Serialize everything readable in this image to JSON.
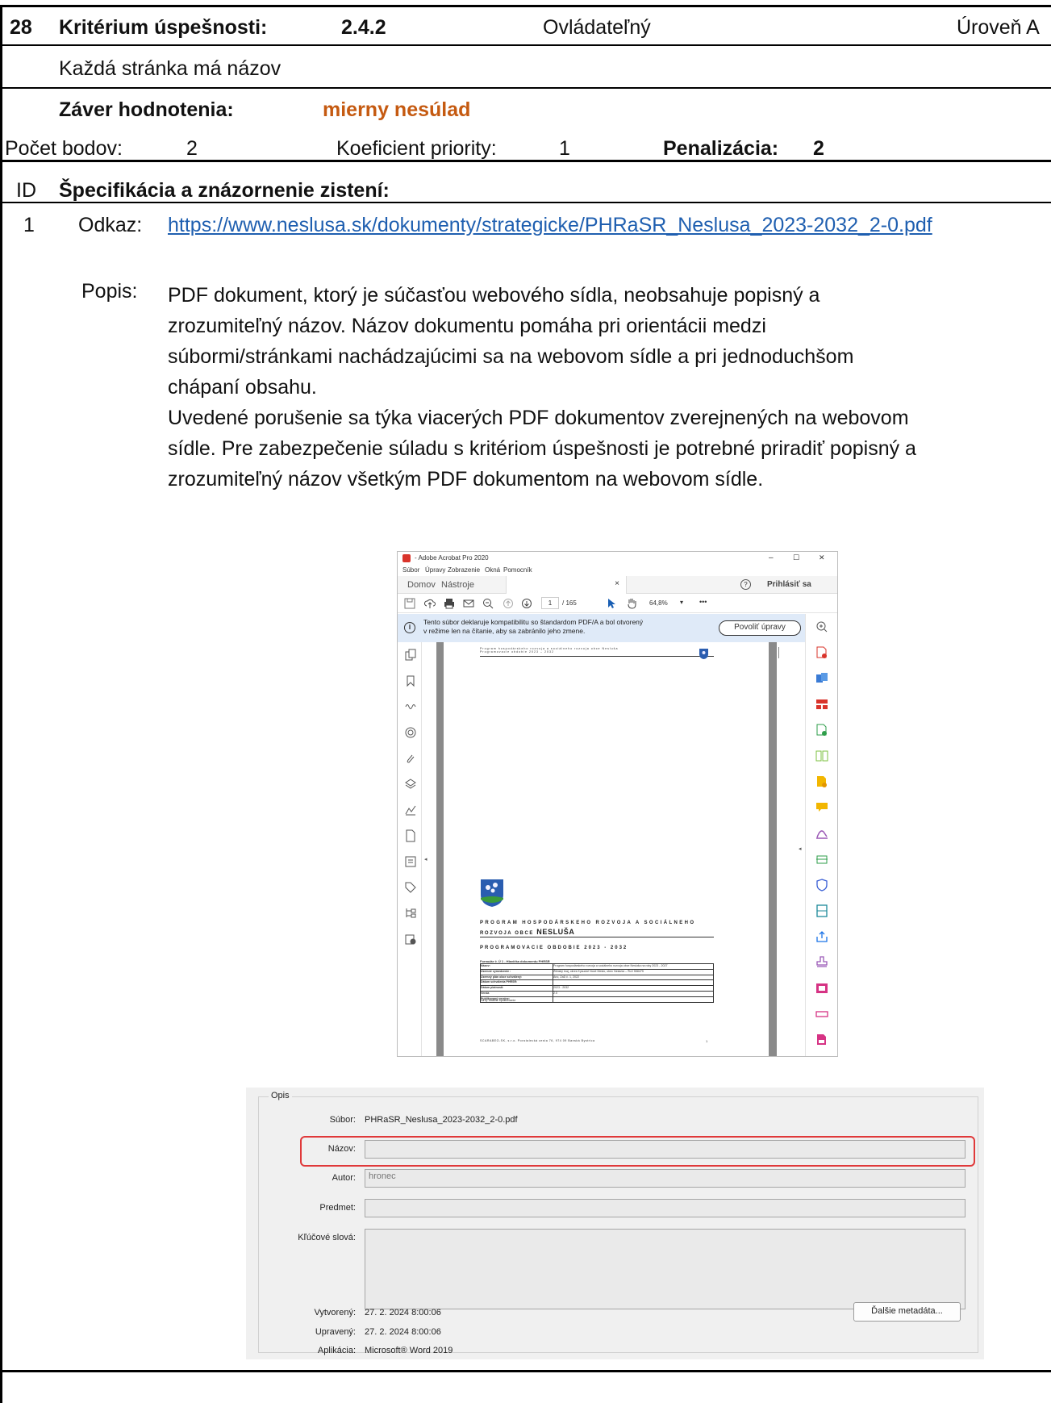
{
  "header": {
    "number": "28",
    "criterion_label": "Kritérium úspešnosti:",
    "criterion_id": "2.4.2",
    "principle": "Ovládateľný",
    "level": "Úroveň A"
  },
  "criterion_title": "Každá stránka má názov",
  "conclusion": {
    "label": "Záver hodnotenia:",
    "value": "mierny nesúlad",
    "value_color": "#c55a11"
  },
  "points": {
    "count_label": "Počet bodov:",
    "count_value": "2",
    "priority_label": "Koeficient priority:",
    "priority_value": "1",
    "penalty_label": "Penalizácia:",
    "penalty_value": "2"
  },
  "spec_header": {
    "id_label": "ID",
    "title": "Špecifikácia a znázornenie zistení:"
  },
  "finding": {
    "id": "1",
    "link_label": "Odkaz:",
    "link_url": "https://www.neslusa.sk/dokumenty/strategicke/PHRaSR_Neslusa_2023-2032_2-0.pdf",
    "link_color": "#1f5fb0",
    "desc_label": "Popis:",
    "desc_lines": [
      "PDF dokument, ktorý je súčasťou webového sídla, neobsahuje popisný a",
      "zrozumiteľný názov. Názov dokumentu pomáha pri orientácii medzi",
      "súbormi/stránkami nachádzajúcimi sa na webovom sídle a pri jednoduchšom",
      "chápaní obsahu.",
      "Uvedené porušenie sa týka viacerých PDF dokumentov zverejnených na webovom",
      "sídle. Pre zabezpečenie súladu s kritériom úspešnosti je potrebné priradiť popisný a",
      "zrozumiteľný názov všetkým PDF dokumentom na webovom sídle."
    ]
  },
  "acrobat": {
    "title": "- Adobe Acrobat Pro 2020",
    "menu": [
      "Súbor",
      "Úpravy",
      "Zobrazenie",
      "Okná",
      "Pomocník"
    ],
    "tabs": [
      "Domov",
      "Nástroje"
    ],
    "tab_close": "×",
    "signin": "Prihlásiť sa",
    "page_current": "1",
    "page_total": "/ 165",
    "zoom": "64,8%",
    "more": "•••",
    "info_line1": "Tento súbor deklaruje kompatibilitu so štandardom PDF/A a bol otvorený",
    "info_line2": "v režime len na čítanie, aby sa zabránilo jeho zmene.",
    "enable_button": "Povoliť úpravy",
    "window_controls": [
      "–",
      "☐",
      "✕"
    ],
    "pdf_page": {
      "header_line1": "Program hospodárskeho rozvoja a sociálneho rozvoja obce Nesluša",
      "header_line2": "Programovacie obdobie 2023 – 2032",
      "title_line1": "PROGRAM HOSPODÁRSKEHO ROZVOJA A SOCIÁLNEHO",
      "title_line2_prefix": "ROZVOJA OBCE",
      "title_line2_name": "NESLUŠA",
      "subtitle": "PROGRAMOVACIE OBDOBIE 2023 - 2032",
      "form_caption": "Formulár č. Ú 1 - Hlavička dokumentu PHRSR",
      "form_rows": [
        {
          "label": "Názov:",
          "value": "Program hospodárskeho rozvoja a sociálneho rozvoja obce Nesluša na roky 2023 - 2027"
        },
        {
          "label": "Územné vymedzenie :",
          "value": "Žilinský kraj, okres Kysucké Nové Mesto, obec Nesluša – ŠUJ 558475"
        },
        {
          "label": "Územný plán obce schválený:",
          "value": "Ano, ZaD č. 1, 2022"
        },
        {
          "label": "Dátum schválenia PHRSR:",
          "value": ""
        },
        {
          "label": "Dátum platnosti:",
          "value": "2023 - 2032"
        },
        {
          "label": "Verzia",
          "value": "2.0"
        },
        {
          "label": "Publikovaný verejne:",
          "value": ""
        }
      ],
      "source": "Zdroj: vlastné spracovanie",
      "footer": "SCARABEO-SK, s.r.o. Povstalecká cesta 76, 974 09 Banská Bystrica",
      "page_number": "1"
    }
  },
  "properties": {
    "group_title": "Opis",
    "file_label": "Súbor:",
    "file_value": "PHRaSR_Neslusa_2023-2032_2-0.pdf",
    "title_label": "Názov:",
    "title_value": "",
    "author_label": "Autor:",
    "author_value": "hronec",
    "subject_label": "Predmet:",
    "subject_value": "",
    "keywords_label": "Kľúčové slová:",
    "keywords_value": "",
    "created_label": "Vytvorený:",
    "created_value": "27. 2. 2024 8:00:06",
    "modified_label": "Upravený:",
    "modified_value": "27. 2. 2024 8:00:06",
    "app_label": "Aplikácia:",
    "app_value": "Microsoft® Word 2019",
    "more_button": "Ďalšie metadáta...",
    "highlight_color": "#e0393a"
  }
}
